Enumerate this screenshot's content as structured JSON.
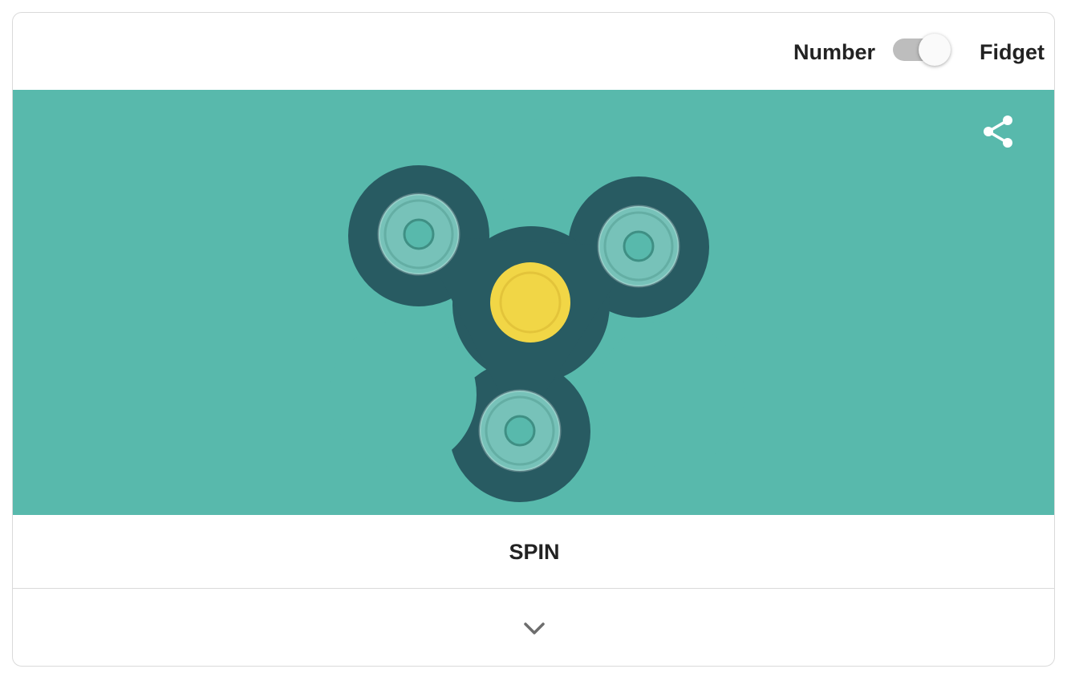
{
  "mode_toggle": {
    "left_label": "Number",
    "right_label": "Fidget",
    "selected": "Fidget"
  },
  "stage": {
    "share_icon": "share-icon"
  },
  "spin_button": {
    "label": "SPIN"
  },
  "expand_button": {
    "icon": "chevron-down-icon"
  },
  "colors": {
    "stage_background": "#58b9ac",
    "spinner_body": "#285b62",
    "bearing_outer": "#77c2b9",
    "bearing_ring": "#64aea4",
    "bearing_hole": "#58b9ac",
    "center_cap": "#f1d646",
    "center_cap_ring": "#e3c43a",
    "toggle_track": "#bdbdbd",
    "toggle_knob": "#fafafa",
    "icon_gray": "#6d6d6d",
    "text": "#222222",
    "border": "#dadada"
  }
}
